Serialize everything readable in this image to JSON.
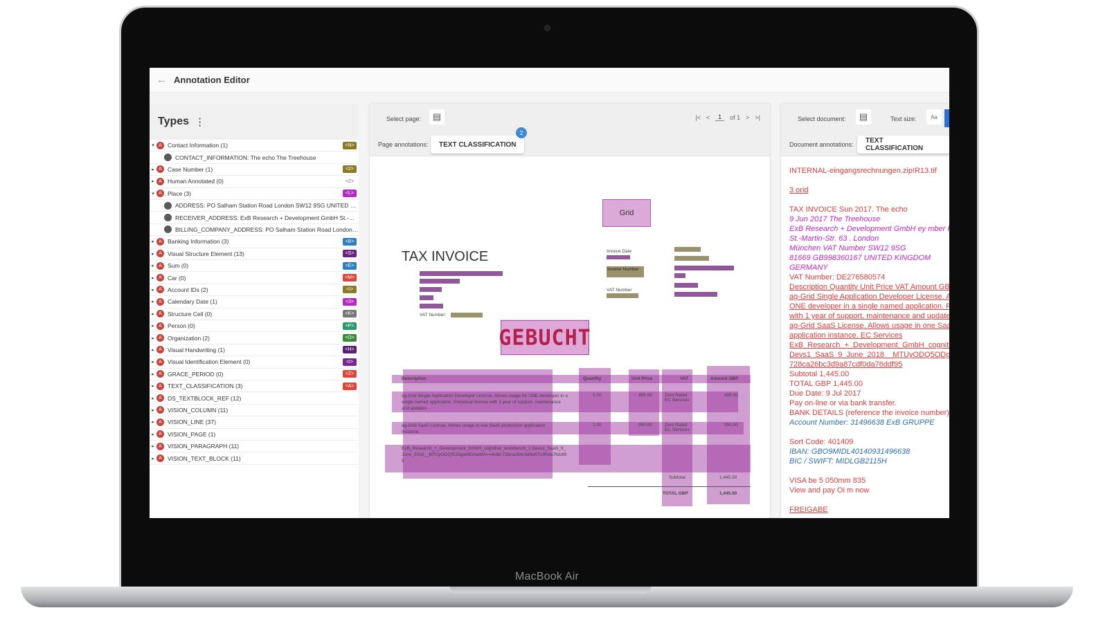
{
  "device_label": "MacBook Air",
  "app": {
    "title": "Annotation Editor"
  },
  "types_panel": {
    "title": "Types",
    "types": [
      {
        "label": "Contact Information (1)",
        "badge": "<N>",
        "color": "#8c7a25",
        "expanded": true
      },
      {
        "label": "CONTACT_INFORMATION: The echo The Treehouse",
        "child": true
      },
      {
        "label": "Case Number (1)",
        "badge": "<2>",
        "color": "#8c7a25"
      },
      {
        "label": "Human Annotated (0)",
        "badge": "<Z>",
        "color": "plain"
      },
      {
        "label": "Place (3)",
        "badge": "<L>",
        "color": "#b628c8",
        "expanded": true
      },
      {
        "label": "ADDRESS: PO Salham Station Road London SW12 9SG UNITED KINGDOM",
        "child": true
      },
      {
        "label": "RECEIVER_ADDRESS: ExB Research + Development GmbH St.-Martin-Str...",
        "child": true
      },
      {
        "label": "BILLING_COMPANY_ADDRESS: PO Salham Station Road London SW12 ...",
        "child": true
      },
      {
        "label": "Banking Information (3)",
        "badge": "<B>",
        "color": "#2c7fc3"
      },
      {
        "label": "Visual Structure Element (13)",
        "badge": "<S>",
        "color": "#6a2480"
      },
      {
        "label": "Sum (0)",
        "badge": "<E>",
        "color": "#2c7fc3"
      },
      {
        "label": "Car (0)",
        "badge": "<M>",
        "color": "#e0443a"
      },
      {
        "label": "Account IDs (2)",
        "badge": "<I>",
        "color": "#8c7a25"
      },
      {
        "label": "Calendary Date (1)",
        "badge": "<3>",
        "color": "#b628c8"
      },
      {
        "label": "Structure Cell (0)",
        "badge": "<K>",
        "color": "#777777"
      },
      {
        "label": "Person (0)",
        "badge": "<P>",
        "color": "#2a9a6e"
      },
      {
        "label": "Organization (2)",
        "badge": "<O>",
        "color": "#3b8a3b"
      },
      {
        "label": "Visual Handwriting (1)",
        "badge": "<H>",
        "color": "#5a2070"
      },
      {
        "label": "Visual Identification Element (0)",
        "badge": "<I>",
        "color": "#7a2690"
      },
      {
        "label": "GRACE_PERIOD (0)",
        "badge": "<Z>",
        "color": "#e0443a"
      },
      {
        "label": "TEXT_CLASSIFICATION (3)",
        "badge": "<A>",
        "color": "#e0443a"
      },
      {
        "label": "DS_TEXTBLOCK_REF (12)",
        "badge": "",
        "color": ""
      },
      {
        "label": "VISION_COLUMN (11)",
        "badge": "",
        "color": ""
      },
      {
        "label": "VISION_LINE (37)",
        "badge": "",
        "color": ""
      },
      {
        "label": "VISION_PAGE (1)",
        "badge": "",
        "color": ""
      },
      {
        "label": "VISION_PARAGRAPH (11)",
        "badge": "",
        "color": ""
      },
      {
        "label": "VISION_TEXT_BLOCK (11)",
        "badge": "",
        "color": ""
      }
    ]
  },
  "page_panel": {
    "select_page_label": "Select page:",
    "page_annotations_label": "Page annotations:",
    "annotation_chip": "TEXT CLASSIFICATION",
    "chip_count": "2",
    "pager": {
      "first": "|<",
      "prev": "<",
      "current": "1",
      "of": "of 1",
      "next": ">",
      "last": ">|"
    },
    "document": {
      "logo": "Grid",
      "title": "TAX INVOICE",
      "vat_number_label": "VAT Number:",
      "invoice_date_label": "Invoice Date",
      "invoice_number_label": "Invoice Number",
      "vat_number_right_label": "VAT Number",
      "stamp": "GEBUCHT",
      "table_headers": [
        "Description",
        "Quantity",
        "Unit Price",
        "VAT",
        "Amount GBP"
      ],
      "rows": [
        {
          "desc": "ag-Grid Single Application Developer License. Allows usage for ONE developer in a single named application. Perpetual license with 1 year of support, maintenance and updates.",
          "qty": "1.00",
          "price": "495.00",
          "vat": "Zero Rated EC Services",
          "amount": "495.00"
        },
        {
          "desc": "ag-Grid SaaS License. Allows usage in one SaaS production application instance.",
          "qty": "1.00",
          "price": "950.00",
          "vat": "Zero Rated EC Services",
          "amount": "950.00"
        },
        {
          "desc": "ExB_Research_+_Development_GmbH_cognitive_workbench_1 Devs1_SaaS_9_June_2018__MTUyODQ5ODgwMDAwMA==4c8d 728ca26bc3d9a87cdf0da76ddf95",
          "qty": "",
          "price": "",
          "vat": "",
          "amount": ""
        }
      ],
      "subtotal_label": "Subtotal",
      "subtotal_value": "1,445.00",
      "total_label": "TOTAL GBP",
      "total_value": "1,445.00"
    }
  },
  "doc_panel": {
    "select_document_label": "Select document:",
    "text_size_label": "Text size:",
    "text_size_value": "Aa",
    "document_annotations_label": "Document annotations:",
    "annotation_chip": "TEXT CLASSIFICATION",
    "lines": [
      {
        "text": "INTERNAL-eingangsrechnungen.zip!R13.tif",
        "style": "red"
      },
      {
        "text": "",
        "style": "gap"
      },
      {
        "text": "3 orid",
        "style": "red u"
      },
      {
        "text": "",
        "style": "gap"
      },
      {
        "text": "TAX INVOICE Sun 2017. The echo",
        "style": "red"
      },
      {
        "text": "9 Jun 2017 The Treehouse",
        "style": "magenta"
      },
      {
        "text": "ExB Research + Development GmbH ey mber P",
        "style": "magenta"
      },
      {
        "text": "St.-Martin-Str. 63 . London",
        "style": "magenta"
      },
      {
        "text": "München VAT Number SW12 9SG",
        "style": "magenta"
      },
      {
        "text": "81669 GB998360167 UNITED KINGDOM",
        "style": "magenta"
      },
      {
        "text": "GERMANY",
        "style": "magenta"
      },
      {
        "text": "VAT Number: DE276580574",
        "style": "red"
      },
      {
        "text": "Description Quantity Unit Price VAT Amount GB",
        "style": "red u"
      },
      {
        "text": "ag-Grid Single Application Developer License. A",
        "style": "red u"
      },
      {
        "text": "ONE developer in a single named application. P",
        "style": "red u"
      },
      {
        "text": "with 1 year of support, maintenance and update",
        "style": "red u"
      },
      {
        "text": "ag-Grid SaaS License. Allows usage in one Saa",
        "style": "red u"
      },
      {
        "text": "application instance. EC Services",
        "style": "red u"
      },
      {
        "text": "ExB_Research_+_Development_GmbH_cognitiv",
        "style": "red u"
      },
      {
        "text": "Devs1_SaaS_9_June_2018__MTUyODQ5ODgw",
        "style": "red u"
      },
      {
        "text": "728ca26bc3d9a87cdf0da76ddf95",
        "style": "red u"
      },
      {
        "text": "Subtotal 1,445.00",
        "style": "red"
      },
      {
        "text": "TOTAL GBP 1,445.00",
        "style": "red"
      },
      {
        "text": "Due Date: 9 Jul 2017",
        "style": "red"
      },
      {
        "text": "Pay on-line or via bank transfer.",
        "style": "red"
      },
      {
        "text": "BANK DETAILS (reference the invoice number)",
        "style": "red"
      },
      {
        "text": "Account Number: 31496638 ExB GRUPPE",
        "style": "blue"
      },
      {
        "text": "",
        "style": "gap"
      },
      {
        "text": "Sort Code: 401409",
        "style": "red"
      },
      {
        "text": "IBAN: GBO9MIDL40140931496638",
        "style": "blue"
      },
      {
        "text": "BIC / SWIFT: MIDLGB2115H",
        "style": "blue"
      },
      {
        "text": "",
        "style": "gap"
      },
      {
        "text": "VISA be 5 050mm 835",
        "style": "red"
      },
      {
        "text": "View and pay Oi m now",
        "style": "red"
      },
      {
        "text": "",
        "style": "gap"
      },
      {
        "text": "FREIGABE",
        "style": "red u"
      }
    ]
  }
}
